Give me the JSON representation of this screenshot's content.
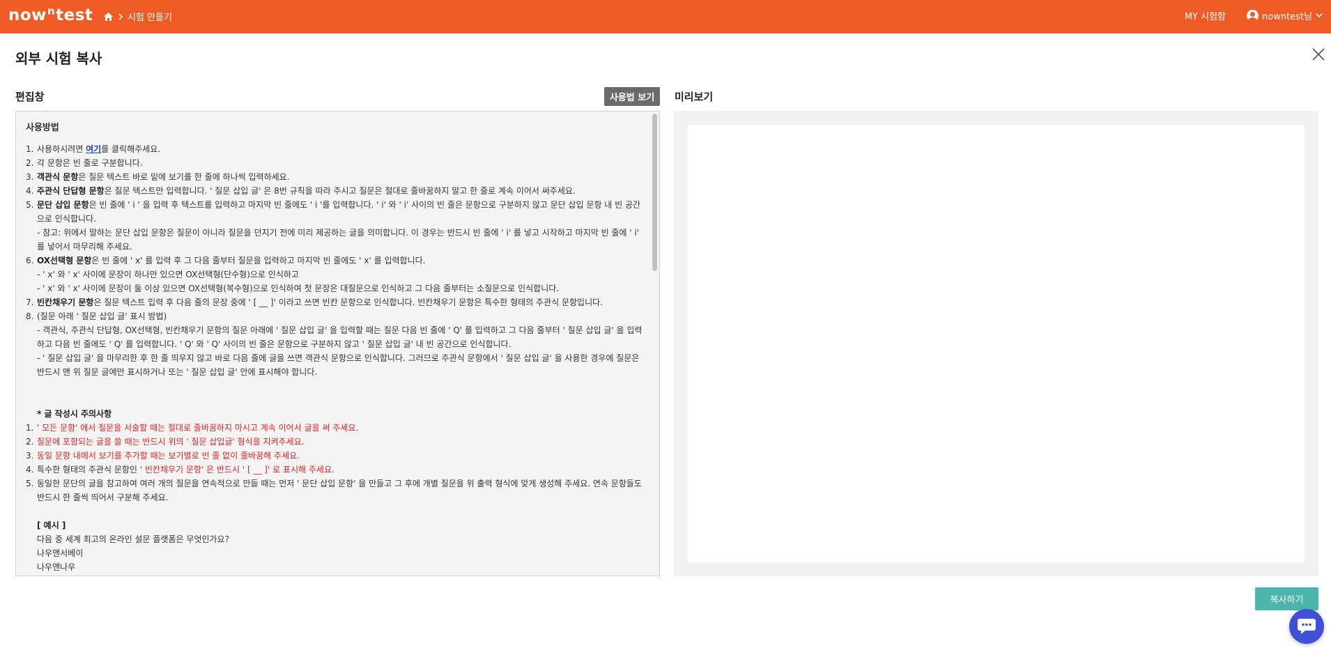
{
  "header": {
    "logo": {
      "pre": "now",
      "sup": "n",
      "post": "test"
    },
    "breadcrumb": {
      "current": "시험 만들기"
    },
    "my_test": "MY 시험함",
    "user": "nowntest님"
  },
  "page": {
    "title": "외부 시험 복사",
    "editor_label": "편집창",
    "guide_button": "사용법 보기",
    "preview_label": "미리보기",
    "copy_button": "복사하기"
  },
  "editor": {
    "heading": "사용방법",
    "items": [
      {
        "num": "1.",
        "parts": [
          {
            "t": "사용하시려면 "
          },
          {
            "t": "여기",
            "link": true
          },
          {
            "t": "를 클릭해주세요."
          }
        ]
      },
      {
        "num": "2.",
        "parts": [
          {
            "t": "각 문항은 빈 줄로 구분합니다."
          }
        ]
      },
      {
        "num": "3.",
        "parts": [
          {
            "t": "객관식 문항",
            "b": true
          },
          {
            "t": "은 질문 텍스트 바로 밑에 보기를 한 줄에 하나씩 입력하세요."
          }
        ]
      },
      {
        "num": "4.",
        "parts": [
          {
            "t": "주관식 단답형 문항",
            "b": true
          },
          {
            "t": "은 질문 텍스트만 입력합니다. ' 질문 삽입 글' 은 8번 규칙을 따라 주시고 질문은 절대로 줄바꿈하지 말고 한 줄로 계속 이어서 써주세요."
          }
        ]
      },
      {
        "num": "5.",
        "parts": [
          {
            "t": "문단 삽입 문항",
            "b": true
          },
          {
            "t": "은 빈 줄에 ' i ' 을 입력 후 텍스트를 입력하고 마지막 빈 줄에도 ' i '를 입력합니다. ' i' 와 ' i' 사이의 빈 줄은 문항으로 구분하지 않고 문단 삽입 문항 내  빈 공간으로 인식합니다."
          }
        ],
        "subs": [
          "- 참고: 위에서 말하는 문단 삽입 문항은 질문이 아니라 질문을 던지기 전에 미리 제공하는 글을 의미합니다. 이 경우는 반드시 빈 줄에 ' i' 를 넣고 시작하고 마지막 빈 줄에 ' i' 를 넣어서 마무리해 주세요."
        ]
      },
      {
        "num": "6.",
        "parts": [
          {
            "t": "OX선택형 문항",
            "b": true
          },
          {
            "t": "은 빈 줄에 ' x' 를 입력 후 그 다음 줄부터 질문을 입력하고 마지막 빈 줄에도 ' x' 를 입력합니다."
          }
        ],
        "subs": [
          "- ' x' 와 ' x'  사이에 문장이 하나만 있으면 OX선택형(단수형)으로 인식하고",
          "- ' x' 와 ' x'  사이에 문장이 둘 이상 있으면 OX선택형(복수형)으로 인식하여 첫 문장은 대질문으로 인식하고 그 다음 줄부터는 소질문으로 인식합니다."
        ]
      },
      {
        "num": "7.",
        "parts": [
          {
            "t": "빈칸채우기 문항",
            "b": true
          },
          {
            "t": "은 질문 텍스트 입력 후 다음 줄의 문장 중에 ' [ __ ]'  이라고 쓰면 빈칸 문항으로 인식합니다. 빈칸채우기 문항은 특수한 형태의 주관식 문항입니다."
          }
        ]
      },
      {
        "num": "8.",
        "parts": [
          {
            "t": "(질문 아래 ' 질문 삽입 글'  표시 방법)"
          }
        ],
        "subs": [
          "- 객관식, 주관식 단답형, OX선택형, 빈칸채우기 문항의 질문 아래에 ' 질문 삽입 글' 을 입력할 때는 질문 다음 빈 줄에 ' Q' 를 입력하고 그 다음 줄부터 ' 질문 삽입 글' 을 입력하고 다음 빈 줄에도 ' Q' 를 입력합니다. ' Q' 와 ' Q'  사이의 빈 줄은 문항으로 구분하지 않고 ' 질문 삽입 글'  내 빈 공간으로 인식합니다.",
          "- ' 질문 삽입 글' 을 마무리한 후 한 줄 띄우지 않고 바로 다음 줄에 글을 쓰면 객관식 문항으로 인식합니다. 그러므로 주관식 문항에서 ' 질문 삽입 글' 을 사용한 경우에 질문은 반드시 맨 위 질문 글에만 표시하거나 또는 ' 질문 삽입 글'  안에 표시해야 합니다."
        ]
      }
    ],
    "caution_heading": "* 글 작성시 주의사항",
    "cautions": [
      {
        "num": "1.",
        "parts": [
          {
            "t": "' 모든 문항' 에서 질문을 서술할 때는 절대로 줄바꿈하지 마시고 계속 이어서 글을 써 주세요.",
            "red": true
          }
        ]
      },
      {
        "num": "2.",
        "parts": [
          {
            "t": "질문에 포함되는 글을 쓸 때는 반드시 위의 ' 질문 삽입글'  형식을 지켜주세요.",
            "red": true
          }
        ]
      },
      {
        "num": "3.",
        "parts": [
          {
            "t": "동일 문항 내에서 보기를 추가할 때는 보기별로 빈 줄 없이 줄바꿈해 주세요.",
            "red": true
          }
        ]
      },
      {
        "num": "4.",
        "parts": [
          {
            "t": "특수한 형태의 주관식 문항인 "
          },
          {
            "t": "' 빈칸채우기 문항' 은 반드시 ' [ __ ]' 로 표시해 주세요.",
            "red": true
          }
        ]
      },
      {
        "num": "5.",
        "parts": [
          {
            "t": "동일한 문단의 글을 참고하여 여러 개의 질문을 연속적으로 만들 때는 먼저 ' 문단 삽입 문항' 을 만들고 그 후에 개별 질문을 위 출력 형식에 맞게 생성해 주세요. 연속 문항들도 반드시 한 줄씩 띄어서 구분해 주세요."
          }
        ]
      }
    ],
    "example_heading": "[ 예시 ]",
    "example_lines": [
      "다음 중 세계 최고의 온라인 설문 플랫폼은 무엇인가요?",
      "나우앤서베이",
      "나우앤나우"
    ]
  }
}
